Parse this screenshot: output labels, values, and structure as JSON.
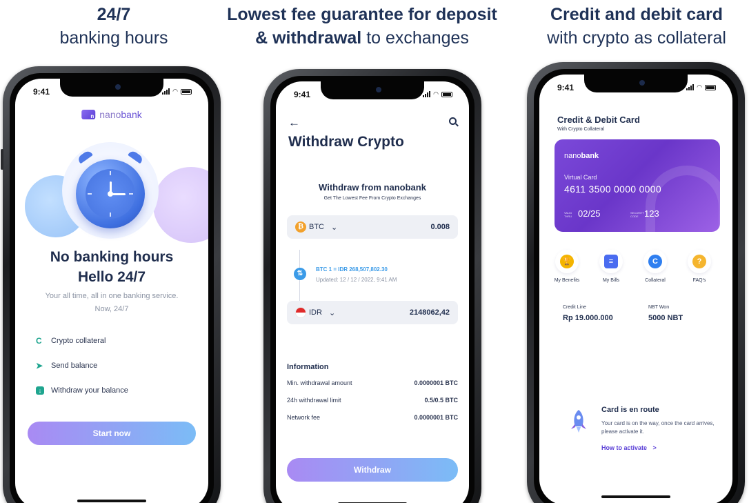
{
  "captions": [
    {
      "bold": "24/7",
      "normal": "banking hours"
    },
    {
      "bold_a": "Lowest fee guarantee for deposit",
      "bold_b": "& withdrawal",
      "normal_b": " to exchanges"
    },
    {
      "bold": "Credit and debit card",
      "normal": "with crypto as collateral"
    }
  ],
  "status_time": "9:41",
  "screen1": {
    "brand_a": "nano",
    "brand_b": "bank",
    "title_line1": "No banking hours",
    "title_line2": "Hello 24/7",
    "subtitle_line1": "Your all time, all in one banking service.",
    "subtitle_line2": "Now, 24/7",
    "features": [
      {
        "icon": "crypto-c-icon",
        "label": "Crypto collateral"
      },
      {
        "icon": "send-arrow-icon",
        "label": "Send balance"
      },
      {
        "icon": "withdraw-down-icon",
        "label": "Withdraw your balance"
      }
    ],
    "cta": "Start now"
  },
  "screen2": {
    "title": "Withdraw Crypto",
    "card_title": "Withdraw from nanobank",
    "card_subtitle": "Get The Lowest Fee From Crypto Exchanges",
    "from_currency": "BTC",
    "from_amount": "0.008",
    "rate": "BTC 1 = IDR 268,507,802.30",
    "updated": "Updated: 12 / 12 / 2022, 9:41 AM",
    "to_currency": "IDR",
    "to_amount": "2148062,42",
    "info_title": "Information",
    "info": [
      {
        "label": "Min. withdrawal amount",
        "value": "0.0000001 BTC"
      },
      {
        "label": "24h withdrawal limit",
        "value": "0.5/0.5 BTC"
      },
      {
        "label": "Network fee",
        "value": "0.0000001 BTC"
      }
    ],
    "cta": "Withdraw"
  },
  "screen3": {
    "title": "Credit & Debit Card",
    "subtitle": "With Crypto Collateral",
    "card": {
      "brand_a": "nano",
      "brand_b": "bank",
      "label": "Virtual Card",
      "number": "4611 3500 0000 0000",
      "valid_thru_label": "VALID THRU",
      "valid_thru": "02/25",
      "security_label": "SECURITY CODE",
      "security_code": "123"
    },
    "actions": [
      {
        "label": "My Benefits",
        "icon": "trophy-icon",
        "color": "#f4b400"
      },
      {
        "label": "My Bills",
        "icon": "bill-icon",
        "color": "#4a6cf0"
      },
      {
        "label": "Collateral",
        "icon": "collateral-c-icon",
        "color": "#2f7ff0"
      },
      {
        "label": "FAQ's",
        "icon": "question-icon",
        "color": "#f5b52e"
      }
    ],
    "credit_line_label": "Credit Line",
    "credit_line_value": "Rp 19.000.000",
    "nbt_label": "NBT Won",
    "nbt_value": "5000 NBT",
    "route_title": "Card is en route",
    "route_desc": "Your card is on the way, once the card arrives, please activate it.",
    "route_link": "How to activate",
    "route_link_arrow": ">"
  },
  "colors": {
    "accent_purple": "#7b49d9",
    "button_gradient_start": "#a98af3",
    "button_gradient_end": "#7bbcf6",
    "bitcoin_orange": "#f2a12c",
    "rate_blue": "#3b9be8"
  }
}
